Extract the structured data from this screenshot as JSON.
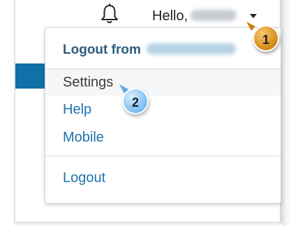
{
  "header": {
    "notifications_icon": "bell-icon",
    "greeting": "Hello,",
    "menu_toggle_icon": "caret-down-icon"
  },
  "dropdown": {
    "header_label": "Logout from",
    "items": [
      {
        "label": "Settings",
        "active": true
      },
      {
        "label": "Help"
      },
      {
        "label": "Mobile"
      },
      {
        "label": "Logout"
      }
    ]
  },
  "callouts": [
    {
      "number": "1",
      "color": "#d38a18"
    },
    {
      "number": "2",
      "color": "#79bdf0"
    }
  ],
  "colors": {
    "link": "#1e73ad",
    "header_text": "#2c5d7f",
    "band": "#0f71a8"
  }
}
